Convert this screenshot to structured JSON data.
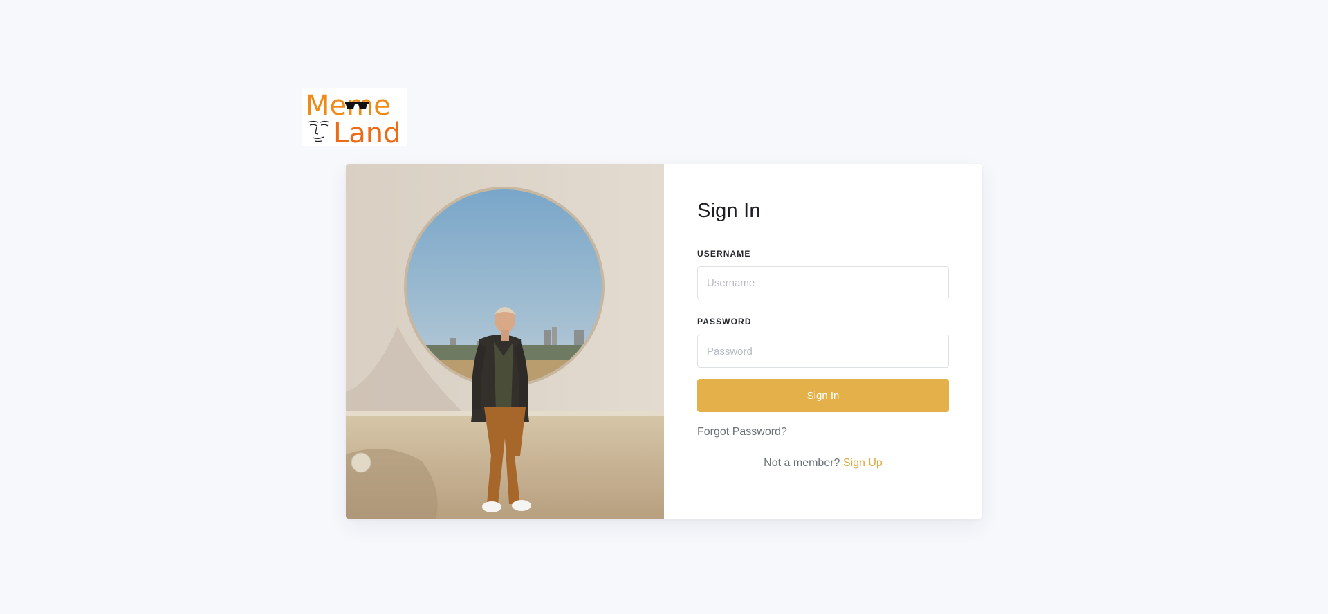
{
  "logo": {
    "line1": "Meme",
    "line2": "Land",
    "colors": {
      "text": "#ef8a17"
    }
  },
  "photo": {
    "alt_icon": "photo-person-circle-window"
  },
  "signin": {
    "title": "Sign In",
    "username": {
      "label": "USERNAME",
      "placeholder": "Username",
      "value": ""
    },
    "password": {
      "label": "PASSWORD",
      "placeholder": "Password",
      "value": ""
    },
    "submit_label": "Sign In",
    "forgot_label": "Forgot Password?",
    "member_prompt": "Not a member?",
    "signup_label": "Sign Up"
  },
  "colors": {
    "page_bg": "#f7f8fc",
    "accent": "#e4b04a",
    "link": "#e4a73c"
  }
}
